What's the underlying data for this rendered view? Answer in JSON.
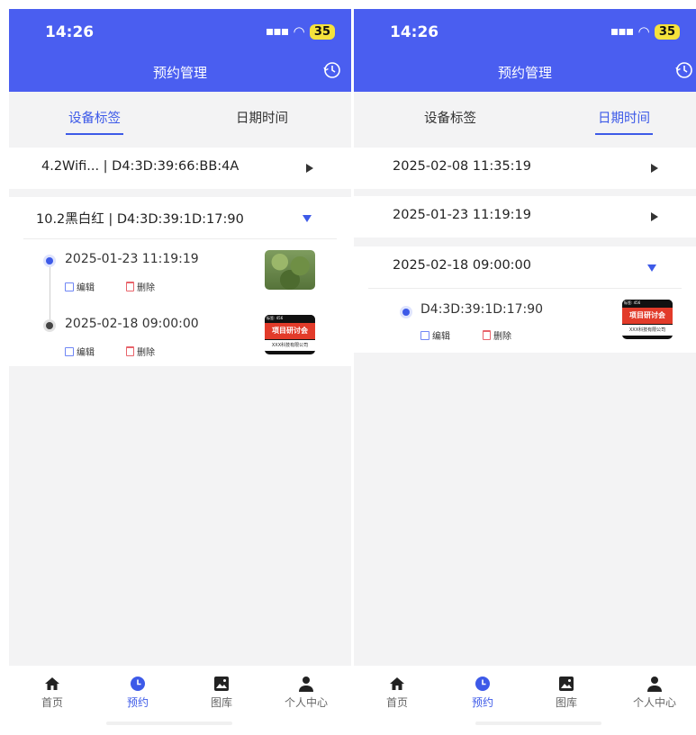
{
  "status": {
    "time": "14:26",
    "battery": "35"
  },
  "header": {
    "title": "预约管理"
  },
  "tabs": [
    "设备标签",
    "日期时间"
  ],
  "left": {
    "rows": [
      {
        "label": "4.2Wifi...  | D4:3D:39:66:BB:4A"
      },
      {
        "label": "10.2黑白红 | D4:3D:39:1D:17:90"
      }
    ],
    "entries": [
      {
        "datetime": "2025-01-23 11:19:19",
        "edit": "编辑",
        "delete": "删除"
      },
      {
        "datetime": "2025-02-18 09:00:00",
        "edit": "编辑",
        "delete": "删除"
      }
    ]
  },
  "right": {
    "rows": [
      {
        "label": "2025-02-08 11:35:19"
      },
      {
        "label": "2025-01-23 11:19:19"
      },
      {
        "label": "2025-02-18 09:00:00"
      }
    ],
    "entries": [
      {
        "device": "D4:3D:39:1D:17:90",
        "edit": "编辑",
        "delete": "删除"
      }
    ]
  },
  "thumb_card": {
    "top": "标签: 456",
    "main": "项目研讨会",
    "sub": "XXX科技有限公司"
  },
  "nav": [
    "首页",
    "预约",
    "图库",
    "个人中心"
  ],
  "colors": {
    "accent": "#3d5ae8",
    "header": "#4a5ef0"
  }
}
